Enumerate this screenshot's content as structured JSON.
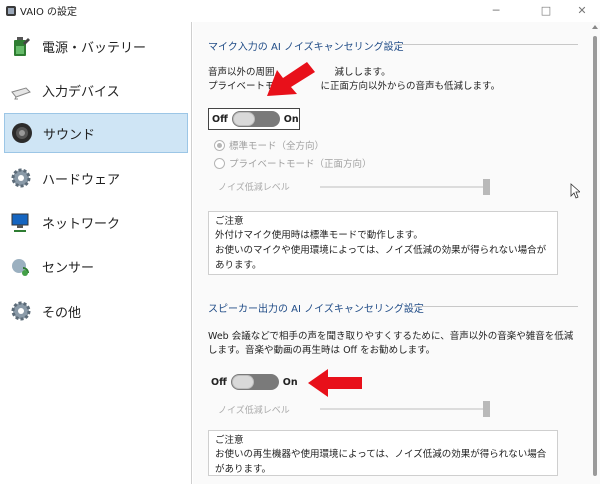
{
  "window": {
    "title": "VAIO の設定",
    "controls": {
      "minimize": "─",
      "maximize": "□",
      "close": "✕"
    }
  },
  "sidebar": {
    "items": [
      {
        "label": "電源・バッテリー",
        "icon": "battery-icon",
        "selected": false
      },
      {
        "label": "入力デバイス",
        "icon": "mouse-icon",
        "selected": false
      },
      {
        "label": "サウンド",
        "icon": "speaker-icon",
        "selected": true
      },
      {
        "label": "ハードウェア",
        "icon": "gear-icon",
        "selected": false
      },
      {
        "label": "ネットワーク",
        "icon": "network-icon",
        "selected": false
      },
      {
        "label": "センサー",
        "icon": "sensor-icon",
        "selected": false
      },
      {
        "label": "その他",
        "icon": "gear-icon",
        "selected": false
      }
    ]
  },
  "mic": {
    "title": "マイク入力の AI ノイズキャンセリング設定",
    "desc_line1": "音声以外の周囲",
    "desc_line1b": "減しします。",
    "desc_line2": "プライベートモ",
    "desc_line2b": "に正面方向以外からの音声も低減します。",
    "toggle": {
      "off": "Off",
      "on": "On",
      "state": "off"
    },
    "radio_standard": "標準モード（全方向）",
    "radio_private": "プライベートモード（正面方向）",
    "slider_label": "ノイズ低減レベル",
    "slider_level": 1.0,
    "note": {
      "title": "ご注意",
      "line1": "外付けマイク使用時は標準モードで動作します。",
      "line2": "お使いのマイクや使用環境によっては、ノイズ低減の効果が得られない場合が",
      "line3": "あります。"
    }
  },
  "speaker": {
    "title": "スピーカー出力の AI ノイズキャンセリング設定",
    "desc_line1": "Web 会議などで相手の声を聞き取りやすくするために、音声以外の音楽や雑音を低減",
    "desc_line2": "します。音楽や動画の再生時は Off をお勧めします。",
    "toggle": {
      "off": "Off",
      "on": "On",
      "state": "off"
    },
    "slider_label": "ノイズ低減レベル",
    "slider_level": 1.0,
    "note": {
      "title": "ご注意",
      "line1": "お使いの再生機器や使用環境によっては、ノイズ低減の効果が得られない場合",
      "line2": "があります。"
    }
  },
  "colors": {
    "accent": "#1f4b86",
    "selected_bg": "#cfe5f5",
    "arrow": "#e8101a"
  }
}
